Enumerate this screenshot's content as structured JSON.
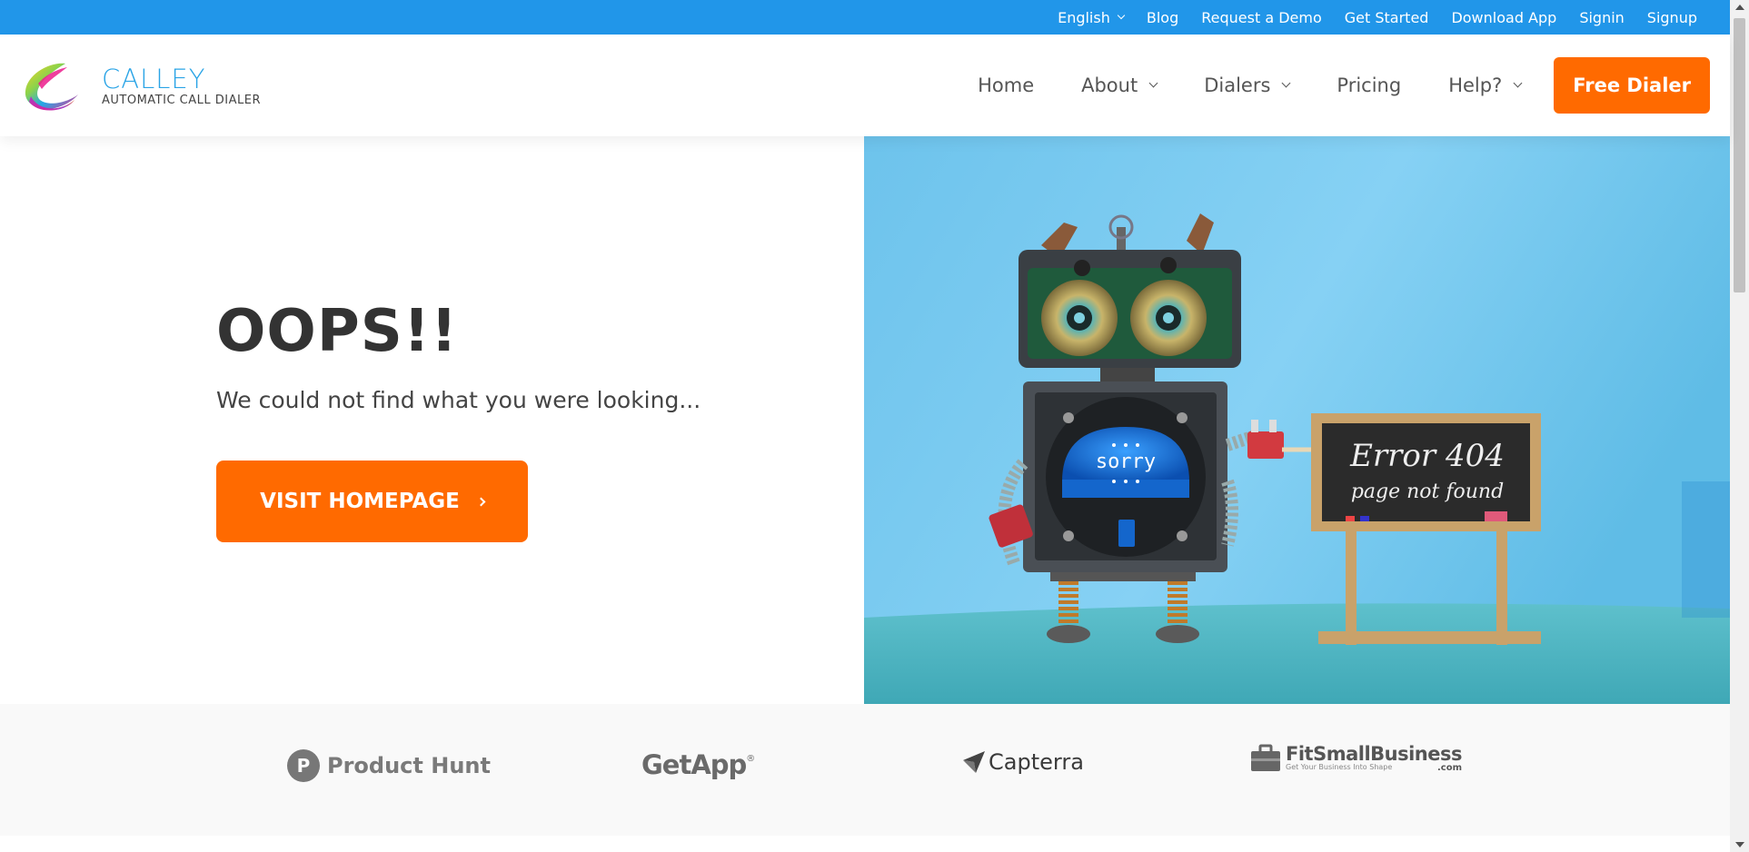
{
  "topbar": {
    "language": "English",
    "links": [
      "Blog",
      "Request a Demo",
      "Get Started",
      "Download App",
      "Signin",
      "Signup"
    ]
  },
  "brand": {
    "name": "CALLEY",
    "tagline": "AUTOMATIC CALL DIALER"
  },
  "nav": {
    "home": "Home",
    "about": "About",
    "dialers": "Dialers",
    "pricing": "Pricing",
    "help": "Help?",
    "cta": "Free Dialer"
  },
  "hero": {
    "title": "OOPS!!",
    "subtitle": "We could not find what you were looking...",
    "button": "VISIT HOMEPAGE",
    "image": {
      "screen_text": "sorry",
      "board_line1": "Error 404",
      "board_line2": "page not found"
    }
  },
  "logos": {
    "product_hunt_letter": "P",
    "product_hunt": "Product Hunt",
    "getapp": "GetApp",
    "getapp_mark": "®",
    "capterra": "Capterra",
    "fitsmall": "FitSmallBusiness",
    "fitsmall_suffix": ".com",
    "fitsmall_tagline": "Get Your Business Into Shape"
  },
  "colors": {
    "topbar": "#2196e9",
    "accent": "#ff6a00",
    "logo_text": "#2aa4e6",
    "hero_bg": "#74c9ee"
  }
}
